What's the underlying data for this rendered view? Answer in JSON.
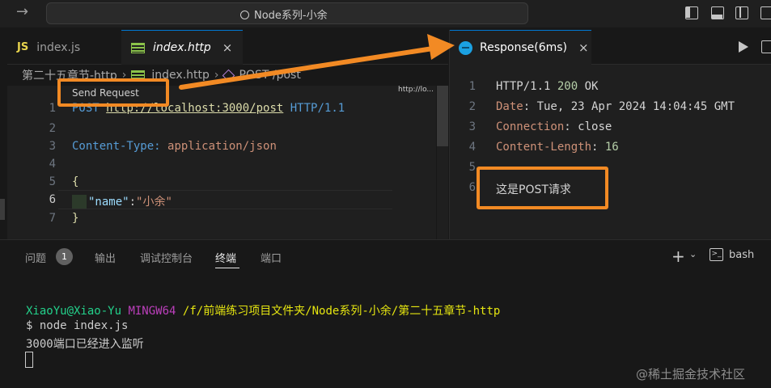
{
  "titlebar": {
    "forward_glyph": "→",
    "search_text": "Node系列-小余"
  },
  "tabs": [
    {
      "badge": "JS",
      "label": "index.js"
    },
    {
      "label": "index.http",
      "close": "×"
    }
  ],
  "response_tab": {
    "label": "Response(6ms)",
    "close": "×"
  },
  "breadcrumb": [
    "第二十五章节-http",
    "index.http",
    "POST /post"
  ],
  "editor": {
    "codelens": "Send Request",
    "minimap_text": "http://lo...",
    "lines": [
      {
        "n": "1",
        "method": "POST",
        "url": "http://localhost:3000/post",
        "version": "HTTP/1.1"
      },
      {
        "n": "2"
      },
      {
        "n": "3",
        "header_key": "Content-Type:",
        "header_value": "application/json"
      },
      {
        "n": "4"
      },
      {
        "n": "5",
        "text": "{"
      },
      {
        "n": "6",
        "key": "\"name\"",
        "colon": ":",
        "value": "\"小余\""
      },
      {
        "n": "7",
        "text": "}"
      }
    ]
  },
  "response": {
    "lines": [
      {
        "n": "1",
        "prefix": "HTTP/1.1 ",
        "status": "200",
        "suffix": " OK"
      },
      {
        "n": "2",
        "key": "Date",
        "value": ": Tue, 23 Apr 2024 14:04:45 GMT"
      },
      {
        "n": "3",
        "key": "Connection",
        "value": ": close"
      },
      {
        "n": "4",
        "key": "Content-Length",
        "value": ": ",
        "num": "16"
      },
      {
        "n": "5"
      },
      {
        "n": "6",
        "body": "这是POST请求"
      }
    ]
  },
  "panel": {
    "tabs": [
      "问题",
      "输出",
      "调试控制台",
      "终端",
      "端口"
    ],
    "problems_count": "1",
    "active_tab": "终端",
    "plus": "+",
    "caret": "⌄",
    "terminal_name": "bash"
  },
  "terminal": {
    "user": "XiaoYu@Xiao-Yu",
    "host": "MINGW64",
    "path": "/f/前端练习项目文件夹/Node系列-小余/第二十五章节-http",
    "command": "$ node index.js",
    "output": "3000端口已经进入监听"
  },
  "watermark": "@稀土掘金技术社区",
  "colors": {
    "highlight": "#f28a24",
    "accent": "#0078d4"
  }
}
